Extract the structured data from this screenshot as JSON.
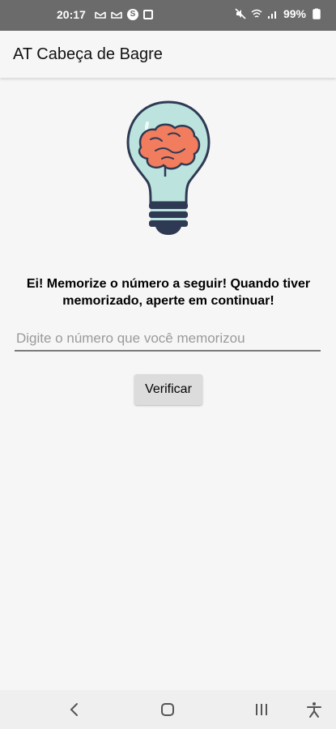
{
  "status_bar": {
    "time": "20:17",
    "battery": "99%",
    "icons": [
      "mail-icon",
      "mail-icon",
      "s-app-icon",
      "gallery-icon",
      "mute-icon",
      "wifi-icon",
      "signal-icon",
      "battery-icon"
    ]
  },
  "app_bar": {
    "title": "AT Cabeça de Bagre"
  },
  "main": {
    "illustration": "lightbulb-brain-icon",
    "instructions": "Ei! Memorize o número a seguir! Quando tiver memorizado, aperte em continuar!",
    "input": {
      "value": "",
      "placeholder": "Digite o número que você memorizou"
    },
    "verify_button_label": "Verificar"
  },
  "nav_bar": {
    "icons": [
      "back-icon",
      "home-icon",
      "recents-icon",
      "accessibility-icon"
    ]
  },
  "colors": {
    "status_bar": "#6b6b6b",
    "background": "#f6f6f6",
    "button": "#dcdcdc",
    "bulb_glass": "#bde3df",
    "brain": "#f17c5e",
    "bulb_base": "#2e3a53"
  }
}
